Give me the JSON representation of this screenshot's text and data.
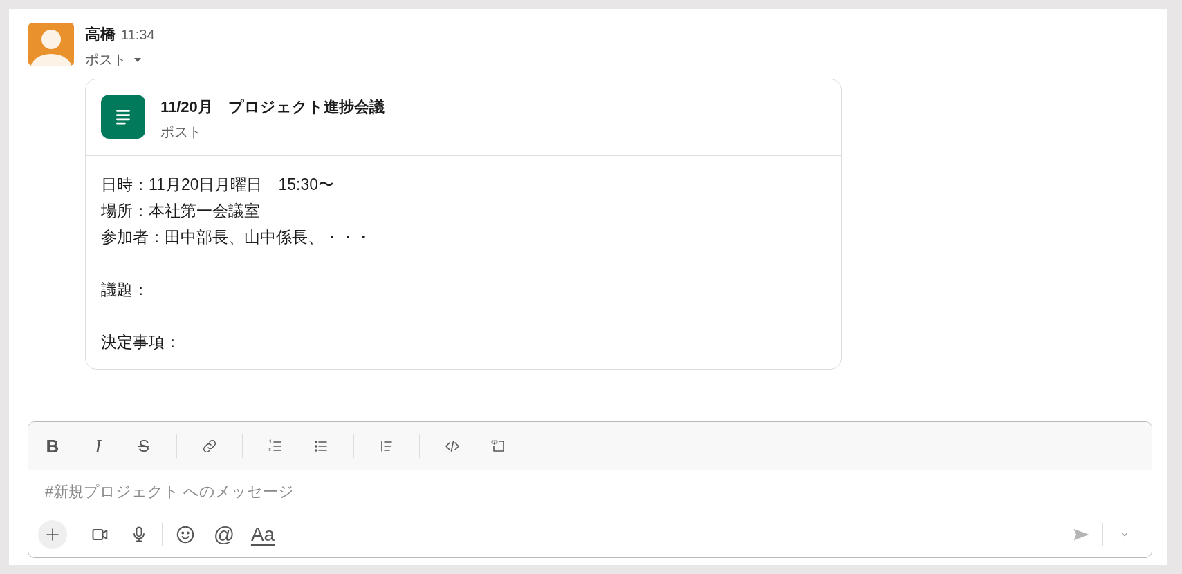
{
  "message": {
    "author": "高橋",
    "time": "11:34",
    "type_label": "ポスト",
    "post": {
      "title": "11/20月　プロジェクト進捗会議",
      "subtitle": "ポスト",
      "paragraphs": [
        [
          "日時：11月20日月曜日　15:30〜",
          "場所：本社第一会議室",
          "参加者：田中部長、山中係長、・・・"
        ],
        [
          "議題："
        ],
        [
          "決定事項："
        ]
      ]
    }
  },
  "composer": {
    "format_toolbar": [
      [
        {
          "kind": "bold",
          "label": "B"
        },
        {
          "kind": "italic",
          "label": "I"
        },
        {
          "kind": "strike",
          "label": "S"
        }
      ],
      [
        {
          "kind": "link"
        }
      ],
      [
        {
          "kind": "ordered-list"
        },
        {
          "kind": "bullet-list"
        }
      ],
      [
        {
          "kind": "quote"
        }
      ],
      [
        {
          "kind": "code"
        },
        {
          "kind": "code-block"
        }
      ]
    ],
    "placeholder": "#新規プロジェクト へのメッセージ",
    "actions": [
      [
        {
          "kind": "plus"
        }
      ],
      [
        {
          "kind": "video"
        },
        {
          "kind": "mic"
        }
      ],
      [
        {
          "kind": "emoji"
        },
        {
          "kind": "mention",
          "label": "@"
        },
        {
          "kind": "format",
          "label": "Aa"
        }
      ]
    ],
    "send_disabled": true
  }
}
